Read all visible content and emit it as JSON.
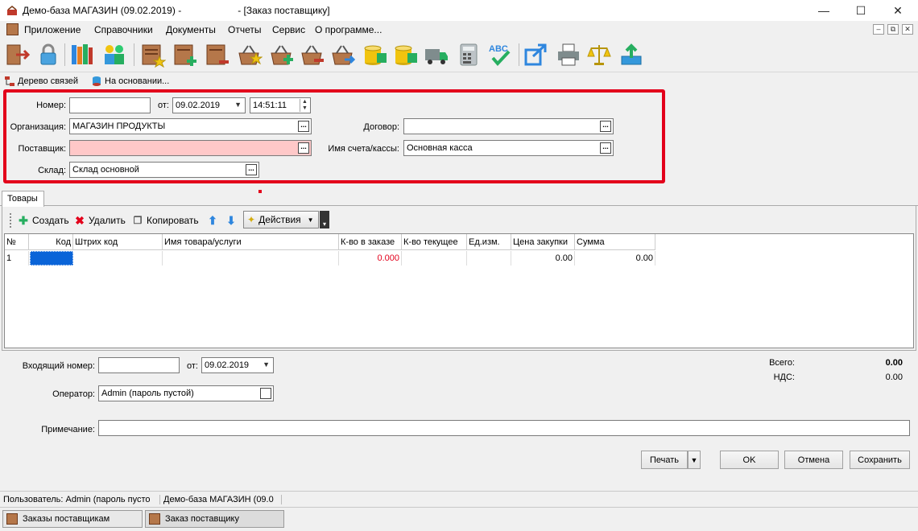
{
  "window": {
    "title": "Демо-база МАГАЗИН (09.02.2019) -                     - [Заказ поставщику]",
    "minimize": "—",
    "maximize": "☐",
    "close": "✕"
  },
  "menu": {
    "items": [
      "Приложение",
      "Справочники",
      "Документы",
      "Отчеты",
      "Сервис",
      "О программе..."
    ],
    "mdi_controls": [
      "‒",
      "⧉",
      "✕"
    ]
  },
  "toolbar": {
    "icons": [
      "exit-icon",
      "lock-icon",
      "books-icon",
      "users-icon",
      "doc-star-icon",
      "doc-add-icon",
      "doc-remove-icon",
      "basket-star-icon",
      "basket-add-icon",
      "basket-remove-icon",
      "basket-move-icon",
      "coins-star-icon",
      "coins-add-icon",
      "truck-icon",
      "calculator-icon",
      "spellcheck-icon",
      "export-icon",
      "printer-icon",
      "scales-icon",
      "upload-icon"
    ],
    "spell_label": "ABC"
  },
  "links": {
    "tree": "Дерево связей",
    "based_on": "На основании..."
  },
  "header_form": {
    "number_label": "Номер:",
    "number_value": "",
    "from_label": "от:",
    "date_value": "09.02.2019",
    "time_value": "14:51:11",
    "org_label": "Организация:",
    "org_value": "МАГАЗИН ПРОДУКТЫ",
    "supplier_label": "Поставщик:",
    "supplier_value": "",
    "warehouse_label": "Склад:",
    "warehouse_value": "Склад основной",
    "contract_label": "Договор:",
    "contract_value": "",
    "account_label": "Имя счета/кассы:",
    "account_value": "Основная касса",
    "ellipsis": "..."
  },
  "tabs": {
    "goods": "Товары"
  },
  "goods_toolbar": {
    "create": "Создать",
    "delete": "Удалить",
    "copy": "Копировать",
    "actions": "Действия"
  },
  "grid": {
    "columns": [
      "№",
      "Код",
      "Штрих код",
      "Имя товара/услуги",
      "К-во в заказе",
      "К-во текущее",
      "Ед.изм.",
      "Цена закупки",
      "Сумма"
    ],
    "rows": [
      {
        "num": "1",
        "code": "",
        "barcode": "",
        "name": "",
        "qty_order": "0.000",
        "qty_current": "",
        "unit": "",
        "price": "0.00",
        "sum": "0.00"
      }
    ],
    "accent_red": "#e3001b"
  },
  "footer_form": {
    "incoming_label": "Входящий номер:",
    "incoming_value": "",
    "from_label": "от:",
    "incoming_date": "09.02.2019",
    "operator_label": "Оператор:",
    "operator_value": "Admin (пароль пустой)",
    "note_label": "Примечание:",
    "note_value": "",
    "total_label": "Всего:",
    "total_value": "0.00",
    "vat_label": "НДС:",
    "vat_value": "0.00"
  },
  "buttons": {
    "print": "Печать",
    "ok": "OK",
    "cancel": "Отмена",
    "save": "Сохранить"
  },
  "status": {
    "user": "Пользователь: Admin (пароль пусто",
    "db": "Демо-база МАГАЗИН (09.0"
  },
  "taskbar": {
    "items": [
      "Заказы поставщикам",
      "Заказ поставщику"
    ]
  }
}
